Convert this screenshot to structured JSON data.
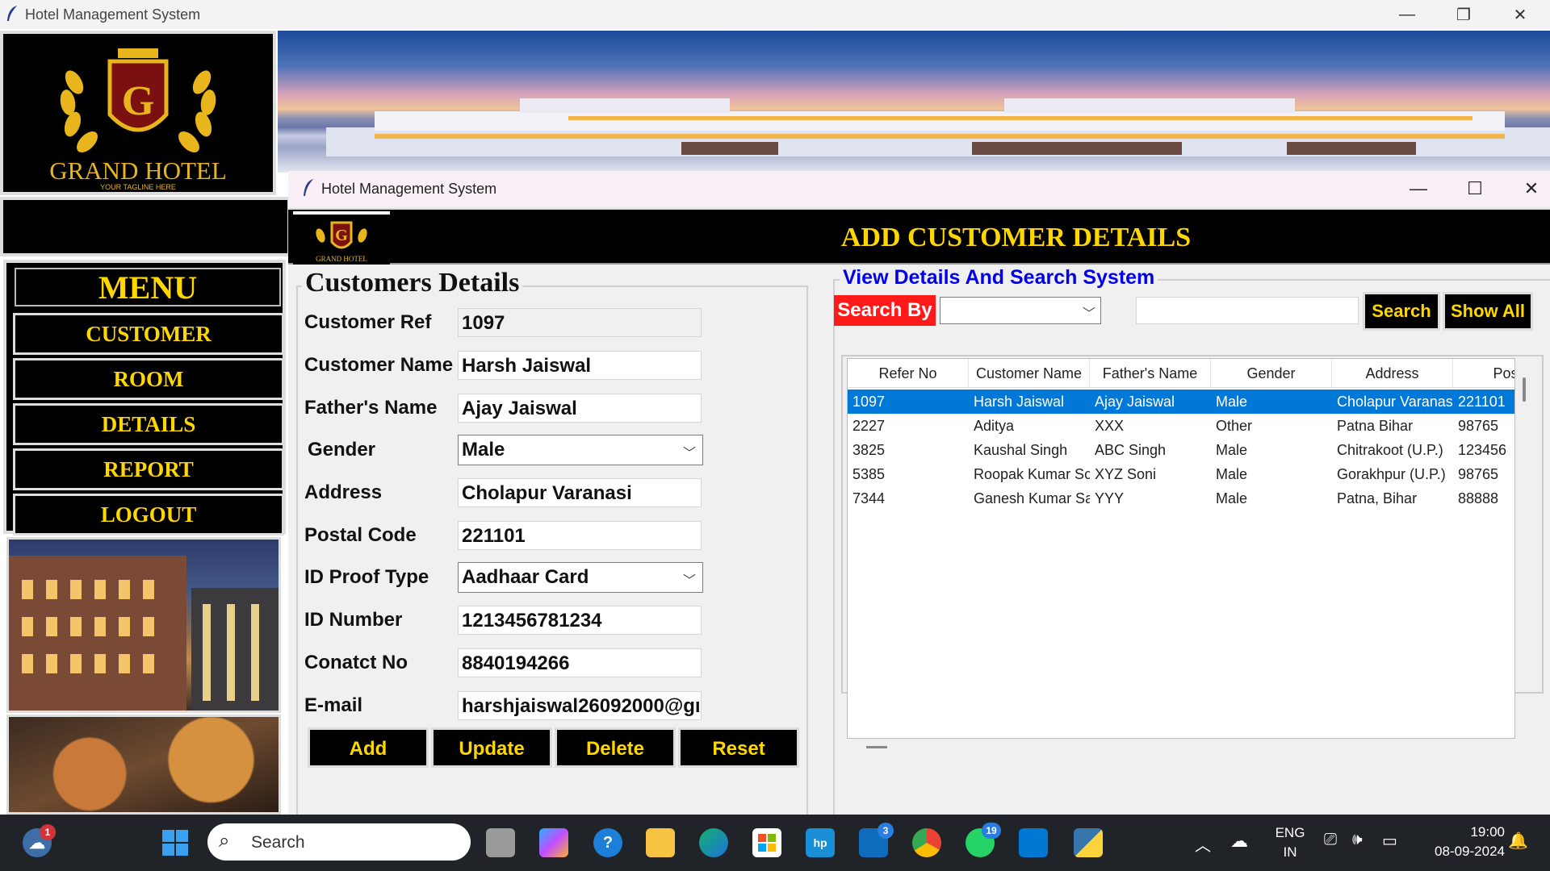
{
  "main_window": {
    "title": "Hotel Management System",
    "controls": {
      "minimize": "—",
      "restore": "❐",
      "close": "✕"
    }
  },
  "logo": {
    "brand": "GRAND HOTEL",
    "tagline": "YOUR TAGLINE HERE",
    "letter": "G"
  },
  "menu": {
    "title": "MENU",
    "items": [
      {
        "label": "CUSTOMER"
      },
      {
        "label": "ROOM"
      },
      {
        "label": "DETAILS"
      },
      {
        "label": "REPORT"
      },
      {
        "label": "LOGOUT"
      }
    ]
  },
  "child_window": {
    "title": "Hotel Management System",
    "controls": {
      "minimize": "—",
      "maximize": "☐",
      "close": "✕"
    },
    "header_title": "ADD CUSTOMER DETAILS",
    "header_logo_text": "GRAND HOTEL"
  },
  "form": {
    "legend": "Customers Details",
    "fields": [
      {
        "label": "Customer Ref",
        "value": "1097"
      },
      {
        "label": "Customer Name",
        "value": "Harsh Jaiswal"
      },
      {
        "label": "Father's Name",
        "value": "Ajay Jaiswal"
      },
      {
        "label": "Gender",
        "value": "Male"
      },
      {
        "label": "Address",
        "value": "Cholapur Varanasi"
      },
      {
        "label": "Postal Code",
        "value": "221101"
      },
      {
        "label": "ID Proof Type",
        "value": "Aadhaar Card"
      },
      {
        "label": "ID Number",
        "value": "1213456781234"
      },
      {
        "label": "Conatct No",
        "value": "8840194266"
      },
      {
        "label": "E-mail",
        "value": "harshjaiswal26092000@gı"
      }
    ],
    "buttons": {
      "add": "Add",
      "update": "Update",
      "delete": "Delete",
      "reset": "Reset"
    }
  },
  "search": {
    "legend": "View Details And Search System",
    "search_by_label": "Search By",
    "search_by_value": "",
    "query": "",
    "search_button": "Search",
    "show_all_button": "Show All"
  },
  "table": {
    "columns": [
      "Refer No",
      "Customer Name",
      "Father's Name",
      "Gender",
      "Address",
      "Postal"
    ],
    "rows": [
      [
        "1097",
        "Harsh Jaiswal",
        "Ajay Jaiswal",
        "Male",
        "Cholapur Varanas",
        "221101"
      ],
      [
        "2227",
        "Aditya",
        "XXX",
        "Other",
        "Patna Bihar",
        "98765"
      ],
      [
        "3825",
        "Kaushal Singh",
        "ABC Singh",
        "Male",
        "Chitrakoot (U.P.)",
        "123456"
      ],
      [
        "5385",
        "Roopak Kumar Sc",
        "XYZ Soni",
        "Male",
        "Gorakhpur (U.P.)",
        "98765"
      ],
      [
        "7344",
        "Ganesh Kumar Sa",
        "YYY",
        "Male",
        "Patna, Bihar",
        "88888"
      ]
    ],
    "selected_row": 0
  },
  "taskbar": {
    "weather_badge": "1",
    "search_label": "Search",
    "mail_badge": "3",
    "whatsapp_badge": "19",
    "lang_top": "ENG",
    "lang_bottom": "IN",
    "time": "19:00",
    "date": "08-09-2024",
    "icons": [
      "weather-icon",
      "start-icon",
      "task-view-icon",
      "copilot-icon",
      "help-icon",
      "file-explorer-icon",
      "edge-icon",
      "store-icon",
      "myhp-icon",
      "outlook-icon",
      "chrome-icon",
      "whatsapp-icon",
      "vscode-icon",
      "python-icon"
    ]
  },
  "colors": {
    "gold": "#ffd700",
    "accent_blue": "#0000ee",
    "search_red": "#ff1a1a",
    "selection": "#0078d7"
  }
}
